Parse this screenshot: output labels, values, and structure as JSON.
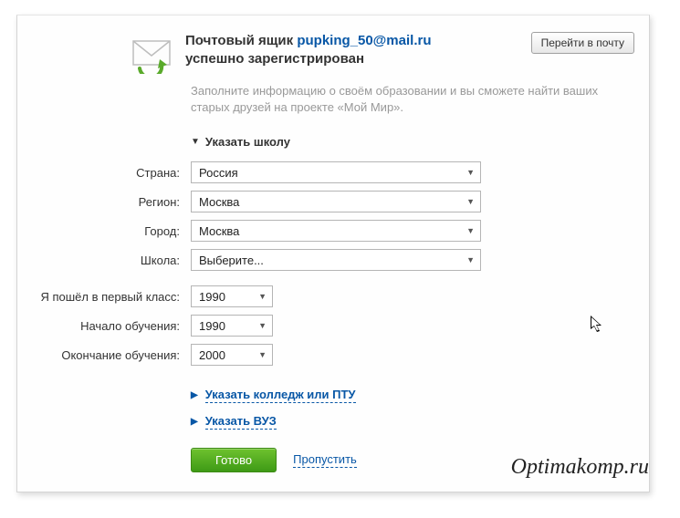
{
  "header": {
    "title_prefix": "Почтовый ящик",
    "email": "pupking_50@mail.ru",
    "title_line2": "успешно зарегистрирован",
    "goto_mail_button": "Перейти в почту"
  },
  "instruction": "Заполните информацию о своём образовании и вы сможете найти ваших старых друзей на проекте «Мой Мир».",
  "section": {
    "school_heading": "Указать школу"
  },
  "form": {
    "country": {
      "label": "Страна:",
      "value": "Россия"
    },
    "region": {
      "label": "Регион:",
      "value": "Москва"
    },
    "city": {
      "label": "Город:",
      "value": "Москва"
    },
    "school": {
      "label": "Школа:",
      "value": "Выберите..."
    },
    "first_grade": {
      "label": "Я пошёл в первый класс:",
      "value": "1990"
    },
    "start_year": {
      "label": "Начало обучения:",
      "value": "1990"
    },
    "end_year": {
      "label": "Окончание обучения:",
      "value": "2000"
    }
  },
  "links": {
    "college": "Указать колледж или ПТУ",
    "university": "Указать ВУЗ"
  },
  "actions": {
    "ready": "Готово",
    "skip": "Пропустить"
  },
  "watermark": "Optimakomp.ru"
}
